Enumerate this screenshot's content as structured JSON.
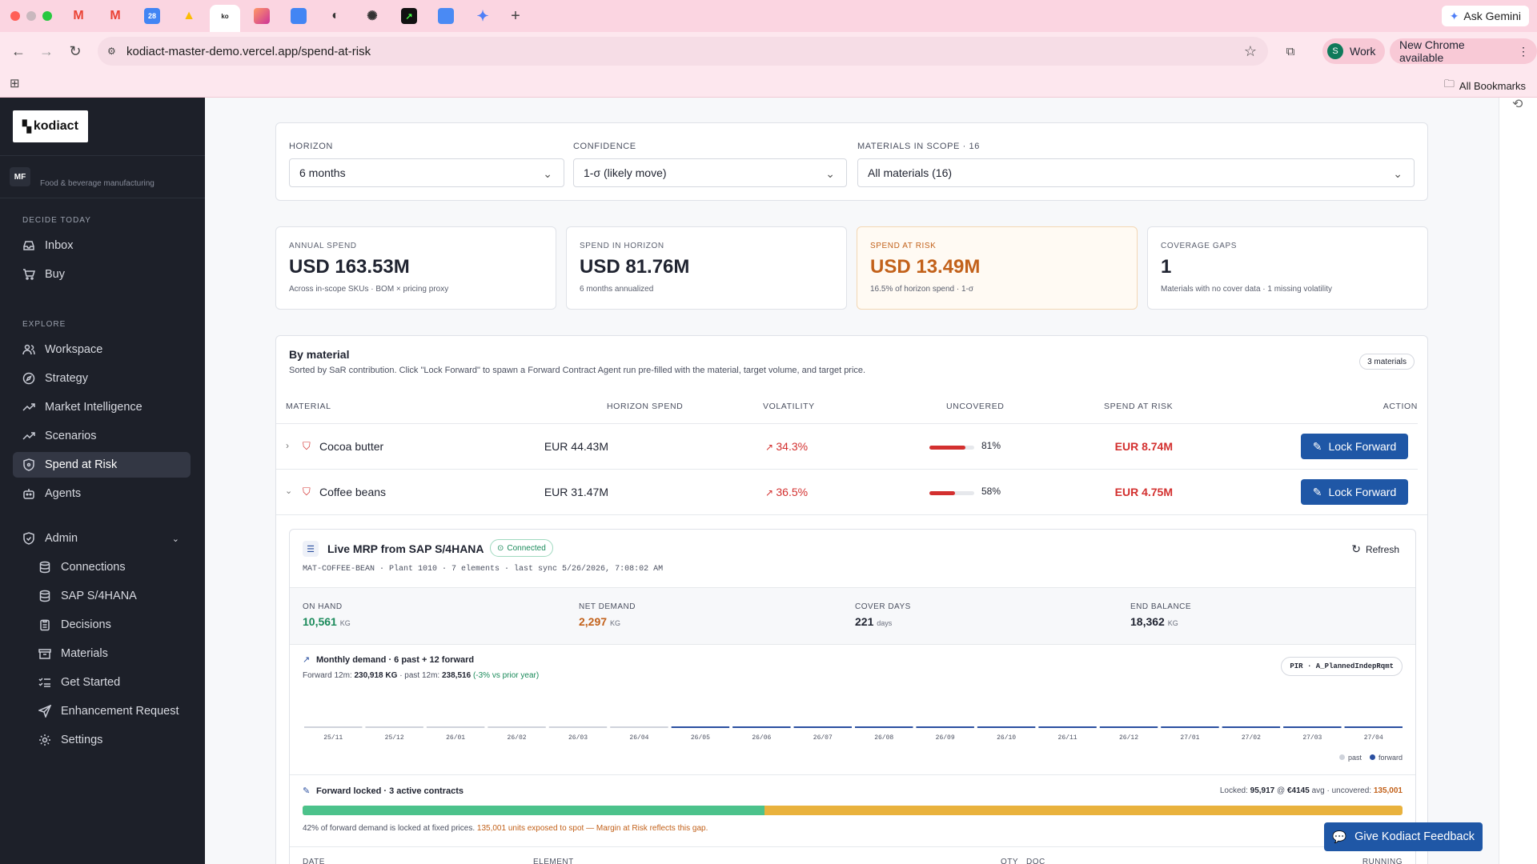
{
  "browser": {
    "tabs": [
      "Gmail",
      "Gmail",
      "Calendar",
      "Drive",
      "Kodiact",
      "App",
      "Docs",
      "Web",
      "ChatGPT",
      "Perplexity",
      "Sheets",
      "Gemini"
    ],
    "ask_gemini": "Ask Gemini",
    "url": "kodiact-master-demo.vercel.app/spend-at-risk",
    "profile_initial": "S",
    "profile_label": "Work",
    "new_chrome": "New Chrome available",
    "all_bookmarks": "All Bookmarks"
  },
  "sidebar": {
    "logo_text": "kodiact",
    "org_badge": "MF",
    "org_name": "Food & beverage manufacturing",
    "section_decide": "DECIDE TODAY",
    "section_explore": "EXPLORE",
    "items": [
      {
        "label": "Inbox",
        "icon": "inbox-icon"
      },
      {
        "label": "Buy",
        "icon": "cart-icon"
      },
      {
        "label": "Workspace",
        "icon": "users-icon"
      },
      {
        "label": "Strategy",
        "icon": "compass-icon"
      },
      {
        "label": "Market Intelligence",
        "icon": "trending-icon"
      },
      {
        "label": "Scenarios",
        "icon": "trending-icon"
      },
      {
        "label": "Spend at Risk",
        "icon": "shield-icon"
      },
      {
        "label": "Agents",
        "icon": "bot-icon"
      },
      {
        "label": "Admin",
        "icon": "shield-icon"
      },
      {
        "label": "Connections",
        "icon": "database-icon"
      },
      {
        "label": "SAP S/4HANA",
        "icon": "database-icon"
      },
      {
        "label": "Decisions",
        "icon": "clipboard-icon"
      },
      {
        "label": "Materials",
        "icon": "box-icon"
      },
      {
        "label": "Get Started",
        "icon": "list-check-icon"
      },
      {
        "label": "Enhancement Request",
        "icon": "send-icon"
      },
      {
        "label": "Settings",
        "icon": "gear-icon"
      }
    ]
  },
  "filters": {
    "horizon_label": "HORIZON",
    "horizon_value": "6 months",
    "confidence_label": "CONFIDENCE",
    "confidence_value": "1-σ (likely move)",
    "materials_label": "MATERIALS IN SCOPE · 16",
    "materials_value": "All materials (16)"
  },
  "kpis": [
    {
      "label": "ANNUAL SPEND",
      "value": "USD 163.53M",
      "sub": "Across in-scope SKUs · BOM × pricing proxy"
    },
    {
      "label": "SPEND IN HORIZON",
      "value": "USD 81.76M",
      "sub": "6 months annualized"
    },
    {
      "label": "SPEND AT RISK",
      "value": "USD 13.49M",
      "sub": "16.5% of horizon spend · 1-σ"
    },
    {
      "label": "COVERAGE GAPS",
      "value": "1",
      "sub": "Materials with no cover data · 1 missing volatility"
    }
  ],
  "by_material": {
    "title": "By material",
    "subtitle": "Sorted by SaR contribution. Click \"Lock Forward\" to spawn a Forward Contract Agent run pre-filled with the material, target volume, and target price.",
    "count_badge": "3 materials",
    "columns": [
      "MATERIAL",
      "HORIZON SPEND",
      "VOLATILITY",
      "UNCOVERED",
      "SPEND AT RISK",
      "ACTION"
    ],
    "rows": [
      {
        "name": "Cocoa butter",
        "spend": "EUR 44.43M",
        "vol": "34.3%",
        "uncovered": "81%",
        "uncovered_pct": 0.81,
        "sar": "EUR 8.74M",
        "action": "Lock Forward"
      },
      {
        "name": "Coffee beans",
        "spend": "EUR 31.47M",
        "vol": "36.5%",
        "uncovered": "58%",
        "uncovered_pct": 0.58,
        "sar": "EUR 4.75M",
        "action": "Lock Forward"
      }
    ]
  },
  "mrp": {
    "title": "Live MRP from SAP S/4HANA",
    "status": "Connected",
    "meta": "MAT-COFFEE-BEAN · Plant 1010 · 7 elements · last sync 5/26/2026, 7:08:02 AM",
    "refresh": "Refresh",
    "stats": [
      {
        "label": "ON HAND",
        "value": "10,561",
        "unit": "KG",
        "color": "#1a8a5a"
      },
      {
        "label": "NET DEMAND",
        "value": "2,297",
        "unit": "KG",
        "color": "#c2611a"
      },
      {
        "label": "COVER DAYS",
        "value": "221",
        "unit": "days",
        "color": "#1f2330"
      },
      {
        "label": "END BALANCE",
        "value": "18,362",
        "unit": "KG",
        "color": "#1f2330"
      }
    ],
    "demand_title": "Monthly demand · 6 past + 12 forward",
    "forward_label": "Forward 12m:",
    "forward_value": "230,918 KG",
    "past_label": "· past 12m:",
    "past_value": "238,516",
    "yoy": "(-3% vs prior year)",
    "pir_tag": "PIR · A_PlannedIndepRqmt",
    "legend_past": "past",
    "legend_forward": "forward"
  },
  "chart_data": {
    "type": "bar",
    "categories": [
      "25/11",
      "25/12",
      "26/01",
      "26/02",
      "26/03",
      "26/04",
      "26/05",
      "26/06",
      "26/07",
      "26/08",
      "26/09",
      "26/10",
      "26/11",
      "26/12",
      "27/01",
      "27/02",
      "27/03",
      "27/04"
    ],
    "series": [
      {
        "name": "past",
        "values": [
          null,
          null,
          null,
          null,
          null,
          null,
          null,
          null,
          null,
          null,
          null,
          null,
          null,
          null,
          null,
          null,
          null,
          null
        ]
      },
      {
        "name": "forward",
        "values": [
          null,
          null,
          null,
          null,
          null,
          null,
          null,
          null,
          null,
          null,
          null,
          null,
          null,
          null,
          null,
          null,
          null,
          null
        ]
      }
    ],
    "past_count": 6,
    "colors": {
      "past": "#cfd3db",
      "forward": "#2a4fa0"
    },
    "legend": "bottom-right"
  },
  "forward": {
    "title": "Forward locked · 3 active contracts",
    "locked_label": "Locked:",
    "locked_value": "95,917",
    "at": "@",
    "avg_price": "€4145",
    "avg_label": "avg · uncovered:",
    "uncovered_value": "135,001",
    "locked_share": 0.42,
    "note_prefix": "42% of forward demand is locked at fixed prices.",
    "note_warn": "135,001 units exposed to spot — Margin at Risk reflects this gap.",
    "table_cols": [
      "DATE",
      "ELEMENT",
      "QTY",
      "DOC",
      "RUNNING"
    ]
  },
  "feedback_button": "Give Kodiact Feedback",
  "colors": {
    "accent": "#1f57a6",
    "risk": "#c2611a",
    "danger": "#d3302f",
    "green": "#4cc28b",
    "amber": "#e9b23d"
  }
}
